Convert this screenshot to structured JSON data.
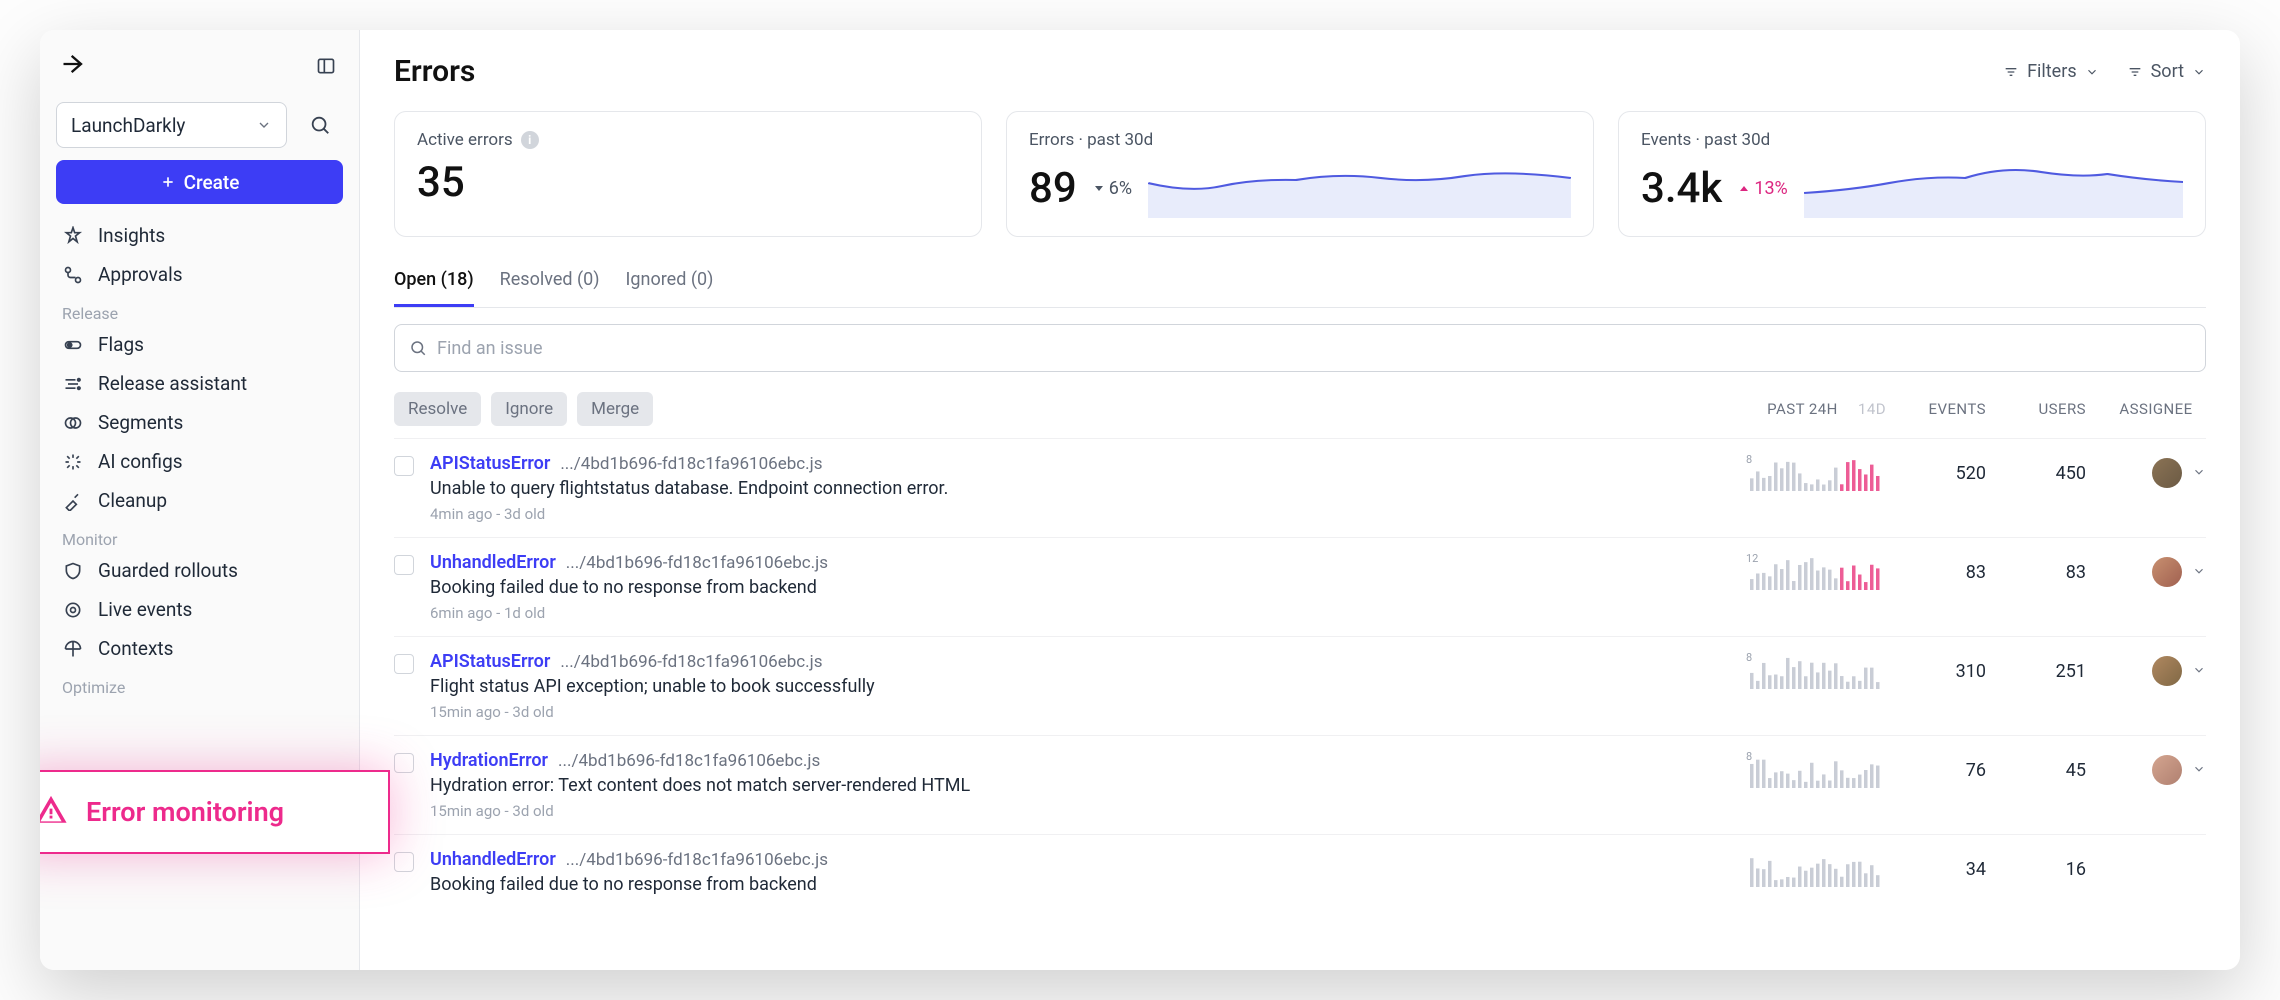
{
  "sidebar": {
    "org": "LaunchDarkly",
    "create": "Create",
    "sections": [
      {
        "items": [
          {
            "key": "insights",
            "label": "Insights"
          },
          {
            "key": "approvals",
            "label": "Approvals"
          }
        ]
      },
      {
        "label": "Release",
        "items": [
          {
            "key": "flags",
            "label": "Flags"
          },
          {
            "key": "release-assistant",
            "label": "Release assistant"
          },
          {
            "key": "segments",
            "label": "Segments"
          },
          {
            "key": "ai-configs",
            "label": "AI configs"
          },
          {
            "key": "cleanup",
            "label": "Cleanup"
          }
        ]
      },
      {
        "label": "Monitor",
        "items": [
          {
            "key": "guarded-rollouts",
            "label": "Guarded rollouts"
          },
          {
            "key": "error-monitoring",
            "label": "Error monitoring"
          },
          {
            "key": "live-events",
            "label": "Live events"
          },
          {
            "key": "contexts",
            "label": "Contexts"
          }
        ]
      },
      {
        "label": "Optimize",
        "items": []
      }
    ]
  },
  "callout": {
    "label": "Error monitoring"
  },
  "header": {
    "title": "Errors",
    "filters": "Filters",
    "sort": "Sort"
  },
  "cards": {
    "active": {
      "label": "Active errors",
      "value": "35"
    },
    "errors30": {
      "label": "Errors · past 30d",
      "value": "89",
      "pct": "6%",
      "dir": "down"
    },
    "events30": {
      "label": "Events · past 30d",
      "value": "3.4k",
      "pct": "13%",
      "dir": "up"
    }
  },
  "tabs": [
    {
      "key": "open",
      "label": "Open (18)",
      "active": true
    },
    {
      "key": "resolved",
      "label": "Resolved (0)"
    },
    {
      "key": "ignored",
      "label": "Ignored (0)"
    }
  ],
  "search": {
    "placeholder": "Find an issue"
  },
  "bulk": {
    "resolve": "Resolve",
    "ignore": "Ignore",
    "merge": "Merge"
  },
  "columns": {
    "past24": "PAST 24H",
    "d14": "14D",
    "events": "EVENTS",
    "users": "USERS",
    "assignee": "ASSIGNEE"
  },
  "rows": [
    {
      "name": "APIStatusError",
      "path": ".../4bd1b696-fd18c1fa96106ebc.js",
      "desc": "Unable to query flightstatus database. Endpoint connection error.",
      "meta": "4min ago - 3d old",
      "peak": "8",
      "events": "520",
      "users": "450",
      "avatar": "a"
    },
    {
      "name": "UnhandledError",
      "path": ".../4bd1b696-fd18c1fa96106ebc.js",
      "desc": "Booking failed due to no response from backend",
      "meta": "6min ago - 1d old",
      "peak": "12",
      "events": "83",
      "users": "83",
      "avatar": "b"
    },
    {
      "name": "APIStatusError",
      "path": ".../4bd1b696-fd18c1fa96106ebc.js",
      "desc": "Flight status API exception; unable to book successfully",
      "meta": "15min ago - 3d old",
      "peak": "8",
      "events": "310",
      "users": "251",
      "avatar": "c"
    },
    {
      "name": "HydrationError",
      "path": ".../4bd1b696-fd18c1fa96106ebc.js",
      "desc": "Hydration error: Text content does not match server-rendered HTML",
      "meta": "15min ago - 3d old",
      "peak": "8",
      "events": "76",
      "users": "45",
      "avatar": "d"
    },
    {
      "name": "UnhandledError",
      "path": ".../4bd1b696-fd18c1fa96106ebc.js",
      "desc": "Booking failed due to no response from backend",
      "meta": "",
      "peak": "",
      "events": "34",
      "users": "16",
      "avatar": ""
    }
  ]
}
